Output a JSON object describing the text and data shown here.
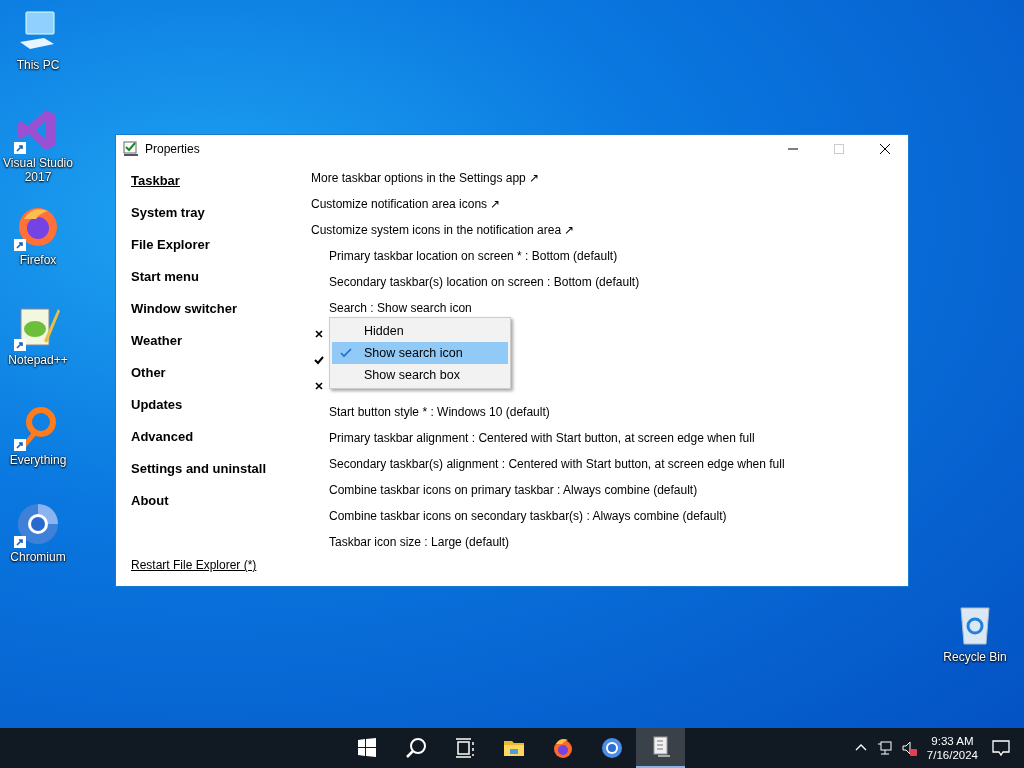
{
  "desktop_icons": [
    {
      "kind": "pc",
      "label": "This PC",
      "shortcut": false
    },
    {
      "kind": "vs",
      "label": "Visual Studio 2017",
      "shortcut": true
    },
    {
      "kind": "firefox",
      "label": "Firefox",
      "shortcut": true
    },
    {
      "kind": "notepad",
      "label": "Notepad++",
      "shortcut": true
    },
    {
      "kind": "everything",
      "label": "Everything",
      "shortcut": true
    },
    {
      "kind": "chromium",
      "label": "Chromium",
      "shortcut": true
    },
    {
      "kind": "recycle",
      "label": "Recycle Bin",
      "shortcut": false
    }
  ],
  "window": {
    "title": "Properties"
  },
  "sidebar": {
    "items": [
      {
        "label": "Taskbar",
        "selected": true
      },
      {
        "label": "System tray",
        "selected": false
      },
      {
        "label": "File Explorer",
        "selected": false
      },
      {
        "label": "Start menu",
        "selected": false
      },
      {
        "label": "Window switcher",
        "selected": false
      },
      {
        "label": "Weather",
        "selected": false
      },
      {
        "label": "Other",
        "selected": false
      },
      {
        "label": "Updates",
        "selected": false
      },
      {
        "label": "Advanced",
        "selected": false
      },
      {
        "label": "Settings and uninstall",
        "selected": false
      },
      {
        "label": "About",
        "selected": false
      }
    ],
    "footer_link": "Restart File Explorer (*)"
  },
  "options": [
    {
      "kind": "link",
      "label": "More taskbar options in the Settings app ↗"
    },
    {
      "kind": "link",
      "label": "Customize notification area icons ↗"
    },
    {
      "kind": "link",
      "label": "Customize system icons in the notification area ↗"
    },
    {
      "kind": "setting",
      "label": "Primary taskbar location on screen * : Bottom (default)"
    },
    {
      "kind": "setting",
      "label": "Secondary taskbar(s) location on screen : Bottom (default)"
    },
    {
      "kind": "setting",
      "label": "Search : Show search icon"
    },
    {
      "kind": "toggle",
      "checked": false
    },
    {
      "kind": "toggle",
      "checked": true
    },
    {
      "kind": "toggle",
      "checked": false
    },
    {
      "kind": "setting",
      "label": "Start button style * : Windows 10 (default)"
    },
    {
      "kind": "setting",
      "label": "Primary taskbar alignment : Centered with Start button, at screen edge when full"
    },
    {
      "kind": "setting",
      "label": "Secondary taskbar(s) alignment : Centered with Start button, at screen edge when full"
    },
    {
      "kind": "setting",
      "label": "Combine taskbar icons on primary taskbar : Always combine (default)"
    },
    {
      "kind": "setting",
      "label": "Combine taskbar icons on secondary taskbar(s) : Always combine (default)"
    },
    {
      "kind": "setting",
      "label": "Taskbar icon size : Large (default)"
    }
  ],
  "dropdown": {
    "items": [
      {
        "label": "Hidden",
        "selected": false
      },
      {
        "label": "Show search icon",
        "selected": true
      },
      {
        "label": "Show search box",
        "selected": false
      }
    ]
  },
  "taskbar": {
    "apps": [
      {
        "kind": "start",
        "selected": false
      },
      {
        "kind": "search",
        "selected": false
      },
      {
        "kind": "taskview",
        "selected": false
      },
      {
        "kind": "explorer",
        "selected": false
      },
      {
        "kind": "firefox",
        "selected": false
      },
      {
        "kind": "chromium",
        "selected": false
      },
      {
        "kind": "properties",
        "selected": true
      }
    ],
    "clock": {
      "time": "9:33 AM",
      "date": "7/16/2024"
    }
  }
}
